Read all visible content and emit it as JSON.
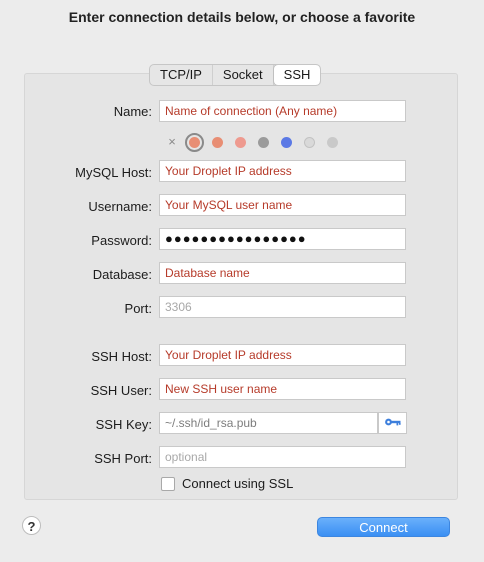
{
  "header": {
    "title": "Enter connection details below, or choose a favorite"
  },
  "tabs": [
    {
      "label": "TCP/IP",
      "active": false
    },
    {
      "label": "Socket",
      "active": false
    },
    {
      "label": "SSH",
      "active": true
    }
  ],
  "form": {
    "name": {
      "label": "Name:",
      "value": "Name of connection (Any name)"
    },
    "colors": {
      "clear_symbol": "×",
      "swatches": [
        "#e88e74",
        "#e88e74",
        "#ee9a8f",
        "#9b9b9b",
        "#5b79e5",
        "#d9d9d9",
        "#c9c9c9"
      ],
      "selected_index": 0
    },
    "mysql_host": {
      "label": "MySQL Host:",
      "value": "Your Droplet IP address"
    },
    "username": {
      "label": "Username:",
      "value": "Your MySQL user name"
    },
    "password": {
      "label": "Password:",
      "value": "●●●●●●●●●●●●●●●●"
    },
    "database": {
      "label": "Database:",
      "value": "Database name"
    },
    "port": {
      "label": "Port:",
      "placeholder": "3306"
    },
    "ssh_host": {
      "label": "SSH Host:",
      "value": "Your Droplet IP address"
    },
    "ssh_user": {
      "label": "SSH User:",
      "value": "New SSH user name"
    },
    "ssh_key": {
      "label": "SSH Key:",
      "value": "~/.ssh/id_rsa.pub",
      "icon": "key-icon"
    },
    "ssh_port": {
      "label": "SSH Port:",
      "placeholder": "optional"
    },
    "ssl": {
      "label": "Connect using SSL",
      "checked": false
    }
  },
  "footer": {
    "help_label": "?",
    "connect_label": "Connect"
  },
  "colors": {
    "accent": "#3a8ff3",
    "field_text_red": "#b63b2a",
    "placeholder_gray": "#a8a8a8"
  }
}
